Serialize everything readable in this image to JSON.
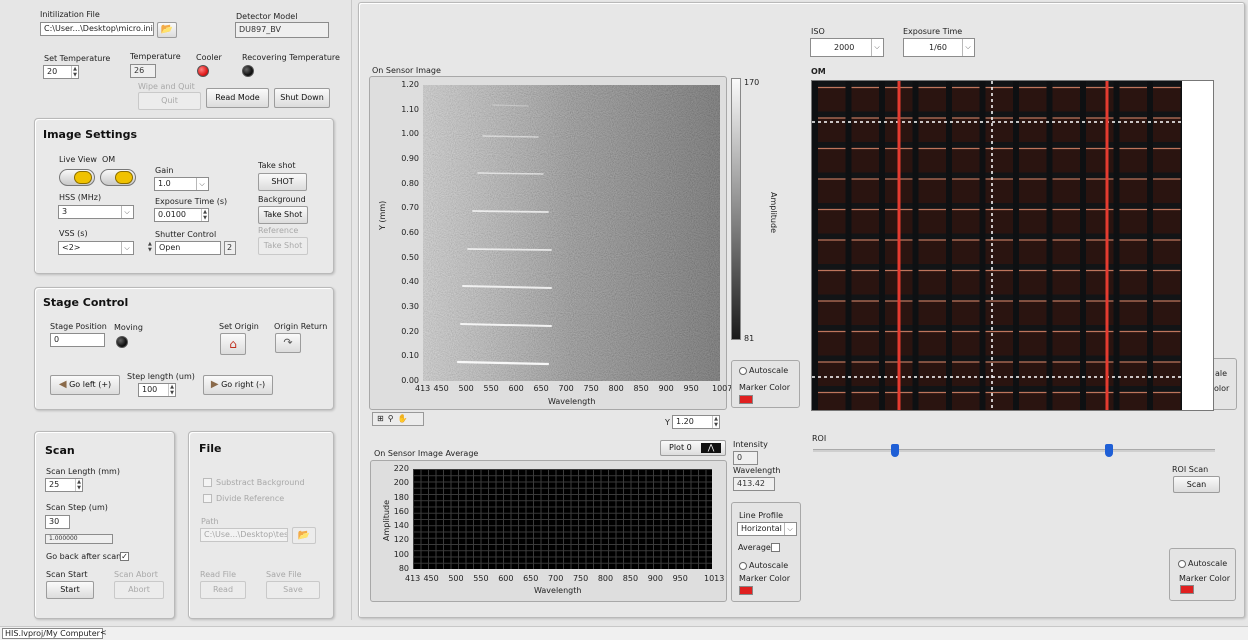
{
  "top": {
    "init_file_label": "Initilization File",
    "init_file_path": "C:\\User...\\Desktop\\micro.ini",
    "detector_model_label": "Detector Model",
    "detector_model_value": "DU897_BV",
    "set_temp_label": "Set Temperature",
    "set_temp_value": "20",
    "temperature_label": "Temperature",
    "temperature_value": "26",
    "cooler_label": "Cooler",
    "recovering_label": "Recovering Temperature",
    "wipe_label": "Wipe and Quit",
    "quit_label": "Quit",
    "read_mode_label": "Read Mode",
    "shut_down_label": "Shut Down"
  },
  "image_settings": {
    "title": "Image Settings",
    "live_view_label": "Live View",
    "om_label": "OM",
    "gain_label": "Gain",
    "gain_value": "1.0",
    "take_shot_label": "Take shot",
    "shot_button": "SHOT",
    "hss_label": "HSS (MHz)",
    "hss_value": "3",
    "exposure_label": "Exposure Time (s)",
    "exposure_value": "0.0100",
    "background_label": "Background",
    "background_button": "Take Shot",
    "vss_label": "VSS (s)",
    "vss_value": "<2>",
    "shutter_label": "Shutter Control",
    "shutter_value": "Open",
    "shutter_index": "2",
    "reference_label": "Reference",
    "reference_button": "Take Shot"
  },
  "stage": {
    "title": "Stage Control",
    "position_label": "Stage Position",
    "position_value": "0",
    "moving_label": "Moving",
    "set_origin_label": "Set Origin",
    "origin_return_label": "Origin Return",
    "go_left": "Go left (+)",
    "step_label": "Step length (um)",
    "step_value": "100",
    "go_right": "Go right (-)"
  },
  "scan": {
    "title": "Scan",
    "length_label": "Scan Length (mm)",
    "length_value": "25",
    "step_label": "Scan Step (um)",
    "step_value": "30",
    "ratio_value": "1.000000",
    "go_back_label": "Go back after scan",
    "go_back_mark": "✓",
    "start_label": "Scan Start",
    "start_button": "Start",
    "abort_label": "Scan Abort",
    "abort_button": "Abort"
  },
  "file": {
    "title": "File",
    "subtract_label": "Substract Background",
    "divide_label": "Divide Reference",
    "path_label": "Path",
    "path_value": "C:\\Use...\\Desktop\\test",
    "read_label": "Read File",
    "read_button": "Read",
    "save_label": "Save File",
    "save_button": "Save"
  },
  "sensor": {
    "title": "On Sensor Image",
    "xlabel": "Wavelength",
    "ylabel": "Y (mm)",
    "xticks": [
      "413",
      "450",
      "500",
      "550",
      "600",
      "650",
      "700",
      "750",
      "800",
      "850",
      "900",
      "950",
      "1007"
    ],
    "yticks": [
      "0.00",
      "0.10",
      "0.20",
      "0.30",
      "0.40",
      "0.50",
      "0.60",
      "0.70",
      "0.80",
      "0.90",
      "1.00",
      "1.10",
      "1.20"
    ],
    "colorbar_max": "170",
    "colorbar_min": "81",
    "colorbar_label": "Amplitude",
    "autoscale_label": "Autoscale",
    "marker_color_label": "Marker Color",
    "marker_color": "#e02020",
    "y_label": "Y",
    "y_value": "1.20"
  },
  "average": {
    "title": "On Sensor Image Average",
    "plot_label": "Plot 0",
    "xlabel": "Wavelength",
    "ylabel": "Amplitude",
    "xticks": [
      "413",
      "450",
      "500",
      "550",
      "600",
      "650",
      "700",
      "750",
      "800",
      "850",
      "900",
      "950",
      "1013"
    ],
    "yticks": [
      "80",
      "100",
      "120",
      "140",
      "160",
      "180",
      "200",
      "220"
    ],
    "intensity_label": "Intensity",
    "intensity_value": "0",
    "wavelength_label": "Wavelength",
    "wavelength_value": "413.42",
    "line_profile_label": "Line Profile",
    "line_profile_value": "Horizontal",
    "average_label": "Average",
    "autoscale_label": "Autoscale",
    "marker_color_label": "Marker Color"
  },
  "om": {
    "iso_label": "ISO",
    "iso_value": "2000",
    "exposure_label": "Exposure Time",
    "exposure_value": "1/60",
    "title": "OM",
    "roi_label": "ROI",
    "roi_scan_label": "ROI Scan",
    "scan_button": "Scan",
    "autoscale_label": "Autoscale",
    "marker_color_label": "Marker Color",
    "hidden_label_1": "ale",
    "hidden_label_2": "olor"
  },
  "status": {
    "path": "HIS.lvproj/My Computer",
    "arrow": "<"
  },
  "colors": {
    "marker": "#e02020",
    "led_red": "#e01b1b",
    "led_off": "#1a1a1a",
    "toggle": "#f0c200"
  }
}
